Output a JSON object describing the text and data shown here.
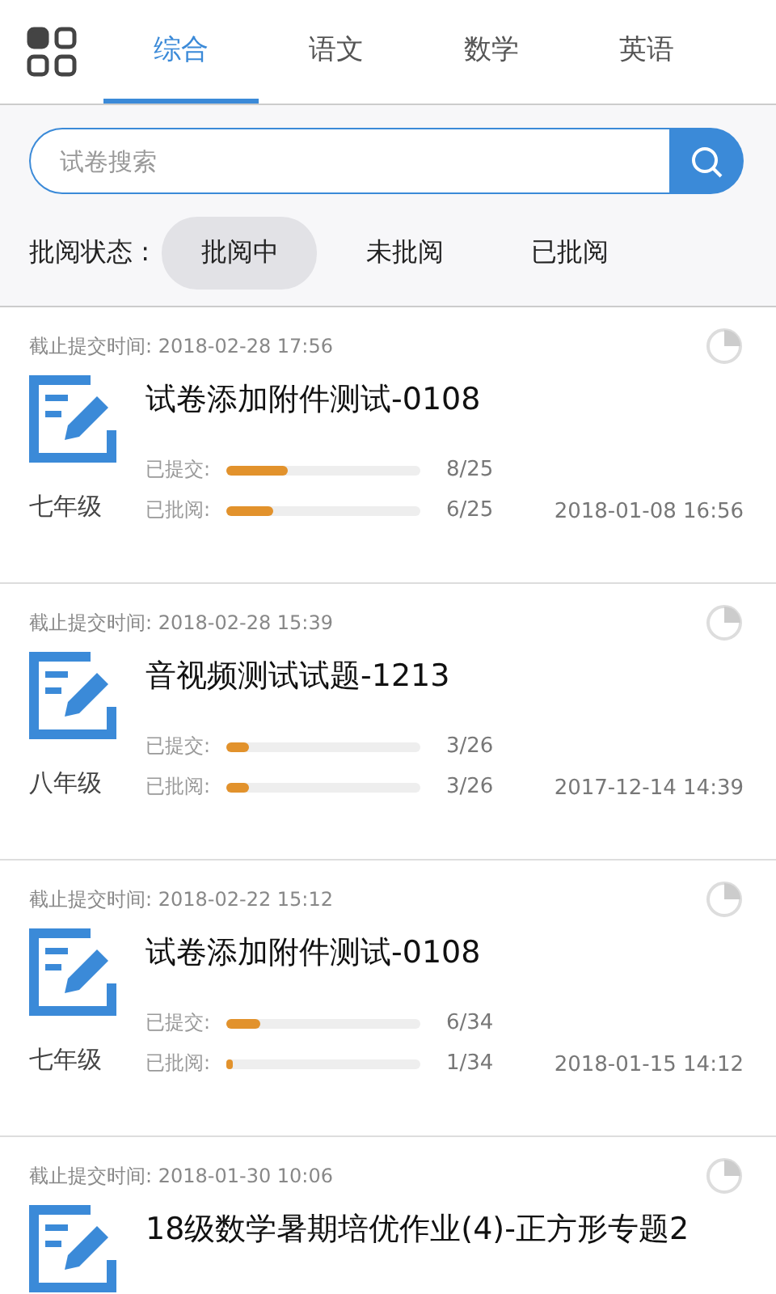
{
  "tabs": [
    {
      "label": "综合",
      "selected": true
    },
    {
      "label": "语文",
      "selected": false
    },
    {
      "label": "数学",
      "selected": false
    },
    {
      "label": "英语",
      "selected": false
    }
  ],
  "search": {
    "placeholder": "试卷搜索"
  },
  "filter": {
    "label": "批阅状态 :",
    "options": [
      {
        "label": "批阅中",
        "selected": true
      },
      {
        "label": "未批阅",
        "selected": false
      },
      {
        "label": "已批阅",
        "selected": false
      }
    ]
  },
  "papers": [
    {
      "deadline": "截止提交时间: 2018-02-28  17:56",
      "title": "试卷添加附件测试-0108",
      "grade": "七年级",
      "date": "2018-01-08  16:56",
      "progress": [
        {
          "label": "已提交:",
          "level": 0.32,
          "count": "8/25"
        },
        {
          "label": "已批阅:",
          "level": 0.24,
          "count": "6/25"
        }
      ]
    },
    {
      "deadline": "截止提交时间: 2018-02-28  15:39",
      "title": "音视频测试试题-1213",
      "grade": "八年级",
      "date": "2017-12-14  14:39",
      "progress": [
        {
          "label": "已提交:",
          "level": 0.115,
          "count": "3/26"
        },
        {
          "label": "已批阅:",
          "level": 0.115,
          "count": "3/26"
        }
      ]
    },
    {
      "deadline": "截止提交时间: 2018-02-22  15:12",
      "title": "试卷添加附件测试-0108",
      "grade": "七年级",
      "date": "2018-01-15  14:12",
      "progress": [
        {
          "label": "已提交:",
          "level": 0.176,
          "count": "6/34"
        },
        {
          "label": "已批阅:",
          "level": 0.03,
          "count": "1/34"
        }
      ]
    },
    {
      "deadline": "截止提交时间: 2018-01-30  10:06",
      "title": "18级数学暑期培优作业(4)-正方形专题2"
    }
  ]
}
